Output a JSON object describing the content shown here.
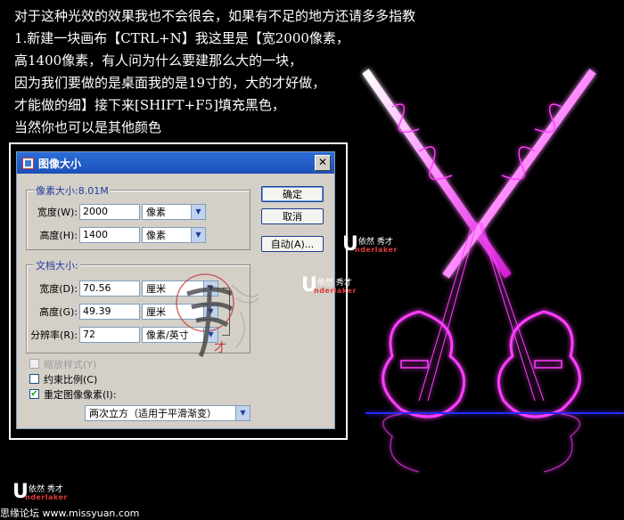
{
  "intro_lines": [
    "对于这种光效的效果我也不会很会，如果有不足的地方还请多多指教",
    "1.新建一块画布【CTRL+N】我这里是【宽2000像素，",
    "高1400像素，有人问为什么要建那么大的一块，",
    "因为我们要做的是桌面我的是19寸的，大的才好做，",
    "才能做的细】接下来[SHIFT+F5]填充黑色，",
    "当然你也可以是其他颜色"
  ],
  "dialog": {
    "title": "图像大小",
    "close": "✕",
    "pixel_group_label": "像素大小:8.01M",
    "width_label": "宽度(W):",
    "width_value": "2000",
    "width_unit": "像素",
    "height_label": "高度(H):",
    "height_value": "1400",
    "height_unit": "像素",
    "doc_group_label": "文档大小:",
    "doc_width_label": "宽度(D):",
    "doc_width_value": "70.56",
    "doc_width_unit": "厘米",
    "doc_height_label": "高度(G):",
    "doc_height_value": "49.39",
    "doc_height_unit": "厘米",
    "resolution_label": "分辨率(R):",
    "resolution_value": "72",
    "resolution_unit": "像素/英寸",
    "scale_styles_label": "缩放样式(Y)",
    "scale_styles_checked": false,
    "constrain_label": "约束比例(C)",
    "constrain_checked": false,
    "resample_label": "重定图像像素(I):",
    "resample_checked": true,
    "resample_method": "两次立方（适用于平滑渐变）",
    "ok_label": "确定",
    "cancel_label": "取消",
    "auto_label": "自动(A)..."
  },
  "logo": {
    "letter": "U",
    "cn_text": "依然 秀才",
    "en_text": "nderlaker"
  },
  "footer": {
    "text": "思缘论坛 www.missyuan.com"
  },
  "colors": {
    "glow": "#ff3cff",
    "dialog_bg": "#d4d0c8",
    "titlebar": "#2a6ed8",
    "accent_text": "#1f3ea0"
  }
}
